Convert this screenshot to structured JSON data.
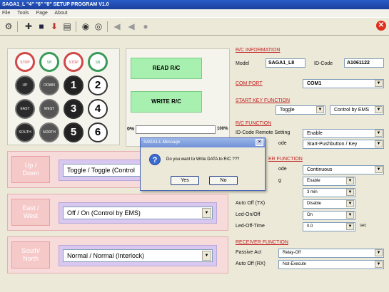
{
  "window": {
    "title": "SAGA1_L \"4\" \"6\" \"8\" SETUP PROGRAM V1.0"
  },
  "menu": [
    "File",
    "Tools",
    "Page",
    "About"
  ],
  "keypad": {
    "buttons": [
      {
        "label": "STOP",
        "style": "ring-red"
      },
      {
        "label": "SB",
        "style": "ring-green"
      },
      {
        "label": "STOP",
        "style": "ring-red"
      },
      {
        "label": "SB",
        "style": "ring-green"
      },
      {
        "label": "UP",
        "style": "dark"
      },
      {
        "label": "DOWN",
        "style": "grey"
      },
      {
        "label": "1",
        "style": "num"
      },
      {
        "label": "2",
        "style": "num"
      },
      {
        "label": "EAST",
        "style": "dark"
      },
      {
        "label": "WEST",
        "style": "grey"
      },
      {
        "label": "3",
        "style": "num"
      },
      {
        "label": "4",
        "style": "num"
      },
      {
        "label": "SOUTH",
        "style": "dark"
      },
      {
        "label": "NORTH",
        "style": "grey"
      },
      {
        "label": "5",
        "style": "num"
      },
      {
        "label": "6",
        "style": "num"
      }
    ]
  },
  "actions": {
    "read": "READ R/C",
    "write": "WRITE R/C",
    "progress_min": "0%",
    "progress_max": "100%"
  },
  "directions": [
    {
      "label": "Up /\nDown",
      "value": "Toggle / Toggle  (Control"
    },
    {
      "label": "East /\nWest",
      "value": "Off    / On     (Control by EMS)"
    },
    {
      "label": "South/\nNorth",
      "value": "Normal / Normal (Interlock)"
    }
  ],
  "rc_info": {
    "title": "R/C INFORMATION",
    "model_label": "Model",
    "model_value": "SAGA1_L8",
    "idcode_label": "ID-Code",
    "idcode_value": "A1061122"
  },
  "com_port": {
    "title": "COM  PORT",
    "value": "COM1"
  },
  "start_key": {
    "title": "START KEY FUNCTION",
    "value1": "Toggle",
    "value2": "Control by EMS"
  },
  "rc_function": {
    "title": "R/C  FUNCTION",
    "row1_label": "ID-Code Remote Setting",
    "row1_value": "Enable",
    "row2_label": "ode",
    "row2_value": "Start-Pushbutton / Key"
  },
  "transmitter": {
    "title": "ER FUNCTION",
    "mode_label": "ode",
    "mode_value": "Continuous",
    "r2_label": "g",
    "r2_value": "Enable",
    "r3_value": "3   min",
    "auto_off_label": "Auto Off (TX)",
    "auto_off_value": "Disable",
    "led_onoff_label": "Led-On/Off",
    "led_onoff_value": "On",
    "led_offtime_label": "Led-Off-Time",
    "led_offtime_value": "0.0",
    "led_offtime_unit": "sec"
  },
  "receiver": {
    "title": "RECEIVER  FUNCTION",
    "passive_label": "Passive Act",
    "passive_value": "Relay-Off",
    "autooff_label": "Auto Off (RX)",
    "autooff_value": "Not-Execute"
  },
  "dialog": {
    "title": "SAGA1-L Message",
    "message": "Do you want to Write DATA to R/C ???",
    "yes": "Yes",
    "no": "No"
  },
  "icons": {
    "toolbar": [
      "settings-icon",
      "pin-icon",
      "save-icon",
      "download-icon",
      "print-icon",
      "option1-icon",
      "option2-icon",
      "connect-icon",
      "connect2-icon",
      "record-icon"
    ],
    "close": "close-icon",
    "question": "question-icon"
  }
}
